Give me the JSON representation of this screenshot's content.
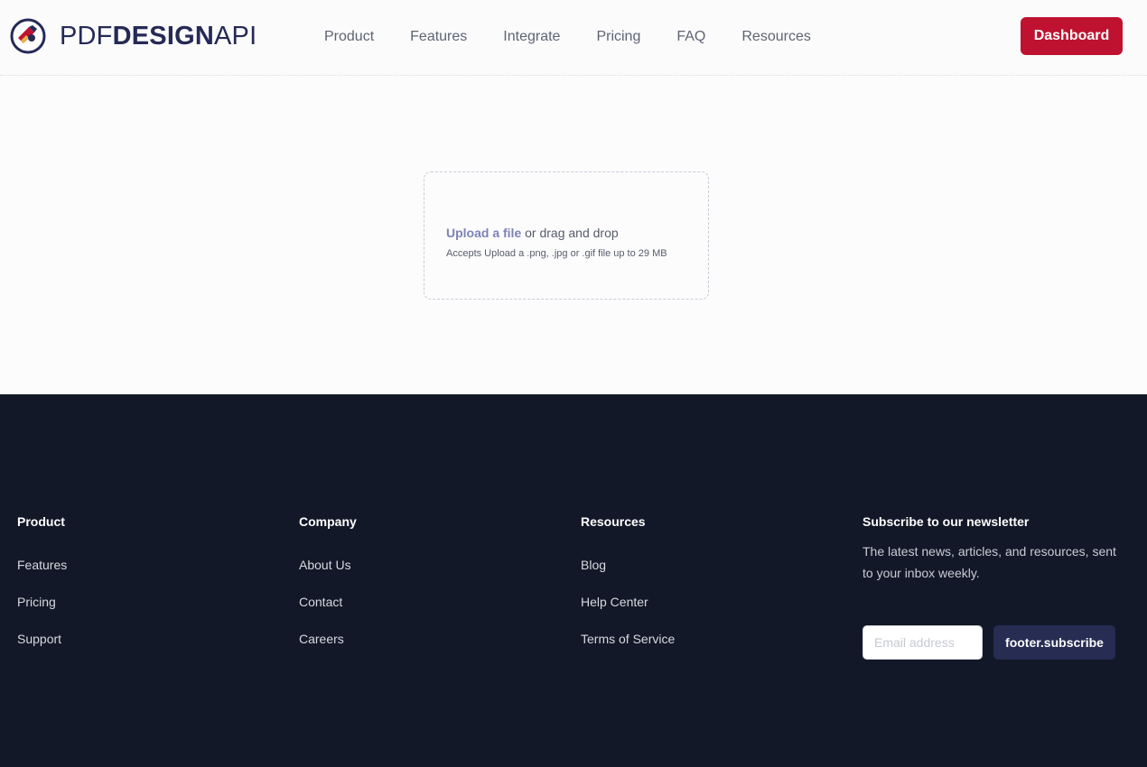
{
  "header": {
    "logo": {
      "part1": "PDF",
      "part2": "DESIGN",
      "part3": "API",
      "icon": "pdf-design-api-logo-icon"
    },
    "nav": [
      {
        "label": "Product"
      },
      {
        "label": "Features"
      },
      {
        "label": "Integrate"
      },
      {
        "label": "Pricing"
      },
      {
        "label": "FAQ"
      },
      {
        "label": "Resources"
      }
    ],
    "dashboard_label": "Dashboard"
  },
  "upload": {
    "link_label": "Upload a file",
    "suffix": " or drag and drop",
    "hint": "Accepts Upload a .png, .jpg or .gif file up to 29 MB"
  },
  "footer": {
    "product": {
      "title": "Product",
      "links": [
        "Features",
        "Pricing",
        "Support"
      ]
    },
    "company": {
      "title": "Company",
      "links": [
        "About Us",
        "Contact",
        "Careers"
      ]
    },
    "resources": {
      "title": "Resources",
      "links": [
        "Blog",
        "Help Center",
        "Terms of Service"
      ]
    },
    "newsletter": {
      "title": "Subscribe to our newsletter",
      "text": "The latest news, articles, and resources, sent to your inbox weekly.",
      "email_placeholder": "Email address",
      "subscribe_label": "footer.subscribe"
    }
  },
  "colors": {
    "brand_navy": "#252a55",
    "brand_red": "#be1230",
    "footer_bg": "#121827",
    "subscribe_bg": "#262c52",
    "link_accent": "#7c82b8"
  }
}
